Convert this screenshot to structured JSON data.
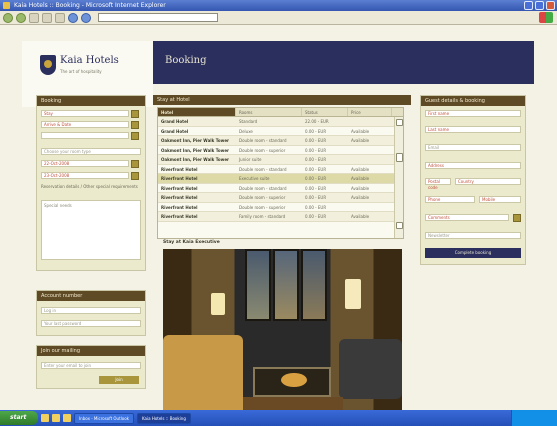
{
  "window": {
    "title": "Kaia Hotels :: Booking - Microsoft Internet Explorer"
  },
  "header": {
    "logo_name": "Kaia Hotels",
    "logo_tagline": "The art of hospitality",
    "page_title": "Booking"
  },
  "left": {
    "booking": {
      "title": "Booking",
      "fields": [
        "Stay",
        "Arrive & Date",
        "",
        "Choose your room type",
        "22-Oct-2008",
        "23-Oct-2008"
      ],
      "notes_label": "Reservation details / Other special requirements",
      "notes_value": "Special needs"
    },
    "account": {
      "title": "Account number",
      "fields": [
        "Log in",
        "Your last password"
      ]
    },
    "newsletter": {
      "title": "Join our mailing",
      "field": "Enter your email to join",
      "button": "Join"
    }
  },
  "grid": {
    "title": "Stay at Hotel",
    "headers": [
      "Hotel",
      "Rooms",
      "Status",
      "Price"
    ],
    "rows": [
      [
        "Grand Hotel",
        "Standard",
        "22.00 - EUR",
        ""
      ],
      [
        "Grand Hotel",
        "Deluxe",
        "0.00 - EUR",
        "Available"
      ],
      [
        "Oakmont Inn, Pier Walk Tower",
        "Double room - standard",
        "0.00 - EUR",
        "Available"
      ],
      [
        "Oakmont Inn, Pier Walk Tower",
        "Double room - superior",
        "0.00 - EUR",
        ""
      ],
      [
        "Oakmont Inn, Pier Walk Tower",
        "Junior suite",
        "0.00 - EUR",
        ""
      ],
      [
        "Riverfront Hotel",
        "Double room - standard",
        "0.00 - EUR",
        "Available"
      ],
      [
        "Riverfront Hotel",
        "Executive suite",
        "0.00 - EUR",
        "Available"
      ],
      [
        "Riverfront Hotel",
        "Double room - standard",
        "0.00 - EUR",
        "Available"
      ],
      [
        "Riverfront Hotel",
        "Double room - superior",
        "0.00 - EUR",
        "Available"
      ],
      [
        "Riverfront Hotel",
        "Double room - superior",
        "0.00 - EUR",
        ""
      ],
      [
        "Riverfront Hotel",
        "Family room - standard",
        "0.00 - EUR",
        "Available"
      ]
    ]
  },
  "photo_label": "Stay at Kaia Executive",
  "right": {
    "title": "Guest details & booking",
    "fields": [
      "First name",
      "Last name",
      "Email",
      "Address",
      "Postal code",
      "Country",
      "Phone",
      "Mobile",
      "Comments",
      "Newsletter"
    ],
    "button": "Complete booking"
  },
  "taskbar": {
    "start": "start",
    "items": [
      "Inbox - Microsoft Outlook",
      "Kaia Hotels :: Booking"
    ]
  },
  "colors": {
    "brand_navy": "#2b2f5e",
    "brand_brown": "#5e4a24",
    "accent_gold": "#a8953c"
  }
}
